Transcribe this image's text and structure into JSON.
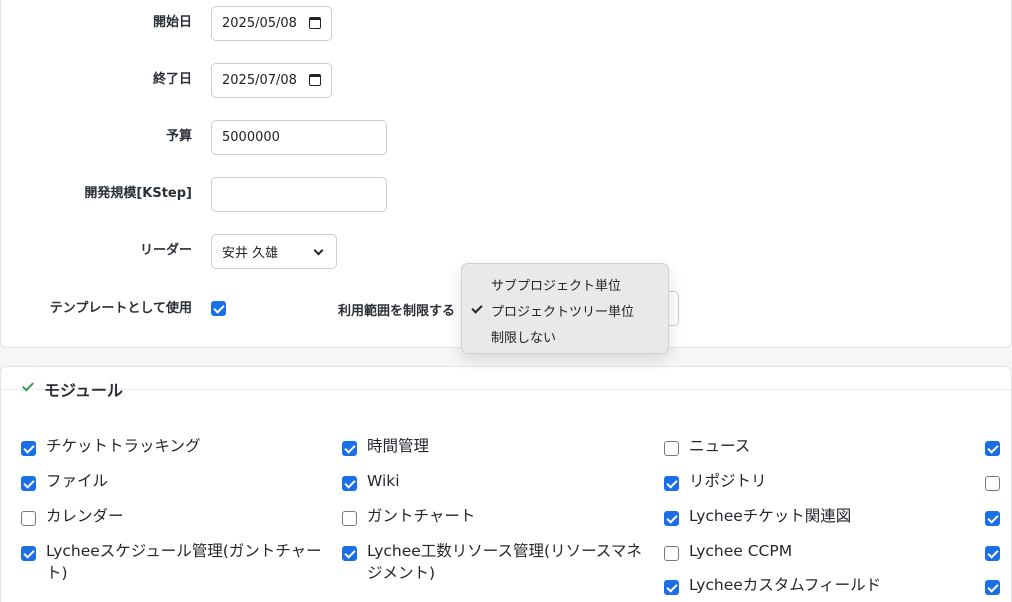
{
  "form": {
    "start_date": {
      "label": "開始日",
      "value": "2025/05/08"
    },
    "end_date": {
      "label": "終了日",
      "value": "2025/07/08"
    },
    "budget": {
      "label": "予算",
      "value": "5000000"
    },
    "dev_scale": {
      "label": "開発規模[KStep]",
      "value": ""
    },
    "leader": {
      "label": "リーダー",
      "value": "安井 久雄"
    },
    "template": {
      "label": "テンプレートとして使用",
      "checked": true
    },
    "scope": {
      "label": "利用範囲を制限する"
    }
  },
  "dropdown": {
    "options": [
      "サブプロジェクト単位",
      "プロジェクトツリー単位",
      "制限しない"
    ],
    "selected_index": 1
  },
  "modules": {
    "title": "モジュール",
    "items": [
      {
        "label": "チケットトラッキング",
        "checked": true
      },
      {
        "label": "時間管理",
        "checked": true
      },
      {
        "label": "ニュース",
        "checked": false
      },
      {
        "label": "",
        "checked": true
      },
      {
        "label": "ファイル",
        "checked": true
      },
      {
        "label": "Wiki",
        "checked": true
      },
      {
        "label": "リポジトリ",
        "checked": true
      },
      {
        "label": "",
        "checked": false
      },
      {
        "label": "カレンダー",
        "checked": false
      },
      {
        "label": "ガントチャート",
        "checked": false
      },
      {
        "label": "Lycheeチケット関連図",
        "checked": true
      },
      {
        "label": "",
        "checked": true
      },
      {
        "label": "Lycheeスケジュール管理(ガントチャート)",
        "checked": true
      },
      {
        "label": "Lychee工数リソース管理(リソースマネジメント)",
        "checked": true
      },
      {
        "label": "Lychee CCPM",
        "checked": false
      },
      {
        "label": "",
        "checked": true
      },
      {
        "label": "Lycheeカスタムフィールド",
        "checked": true
      },
      {
        "label": "",
        "checked": true
      }
    ]
  },
  "colors": {
    "accent": "#1a6fe6",
    "section_check": "#3a9a52"
  }
}
